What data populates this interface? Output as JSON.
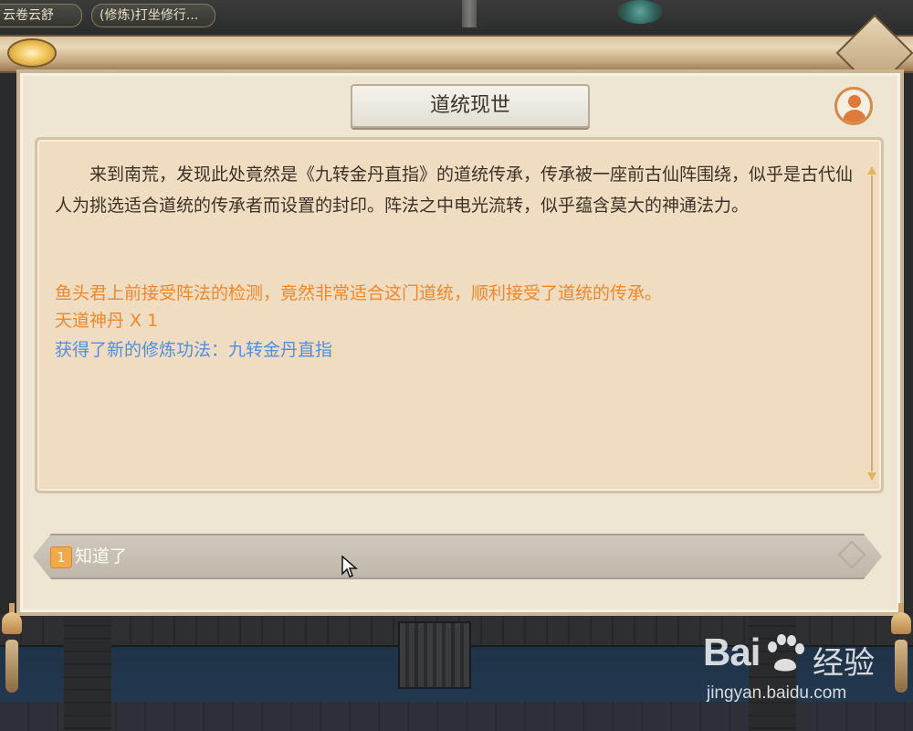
{
  "hud": {
    "tab_left": "云卷云舒",
    "tab_right": "(修炼)打坐修行..."
  },
  "dialog": {
    "title": "道统现世",
    "story": "来到南荒，发现此处竟然是《九转金丹直指》的道统传承，传承被一座前古仙阵围绕，似乎是古代仙人为挑选适合道统的传承者而设置的封印。阵法之中电光流转，似乎蕴含莫大的神通法力。",
    "results": [
      "鱼头君上前接受阵法的检测，竟然非常适合这门道统，顺利接受了道统的传承。",
      "天道神丹 X 1",
      "获得了新的修炼功法：九转金丹直指"
    ],
    "option": {
      "number": "1",
      "label": "知道了"
    }
  },
  "watermark": {
    "logo_left": "Bai",
    "logo_right": "经验",
    "url": "jingyan.baidu.com"
  },
  "colors": {
    "result_orange": "#f0882a",
    "result_blue": "#4f8ee0",
    "panel_bg": "#efe5d3",
    "text_area_bg": "#f0dcc0"
  },
  "icons": [
    "avatar-icon",
    "scroll-up-icon",
    "scroll-down-icon",
    "mouse-cursor-icon",
    "baidu-paw-icon"
  ]
}
